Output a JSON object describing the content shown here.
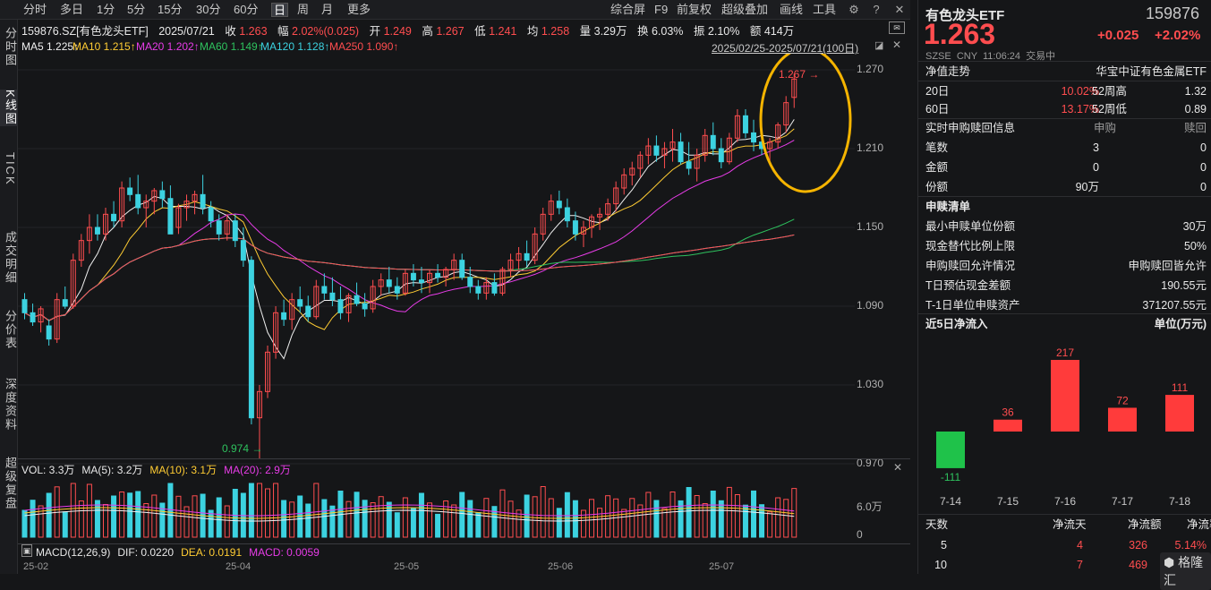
{
  "toolbar": {
    "tabs": [
      "分时",
      "多日",
      "1分",
      "5分",
      "15分",
      "30分",
      "60分",
      "日",
      "周",
      "月",
      "更多"
    ],
    "active_tab": "日",
    "right_items": [
      "综合屏",
      "F9",
      "前复权",
      "超级叠加",
      "画线",
      "工具"
    ]
  },
  "left_tabs": [
    "分时图",
    "K线图",
    "TICK",
    "成交明细",
    "分价表",
    "深度资料",
    "超级复盘"
  ],
  "info": {
    "code_name": "159876.SZ[有色龙头ETF]",
    "date": "2025/07/21",
    "close_label": "收",
    "close": "1.263",
    "change_label": "幅",
    "change": "2.02%(0.025)",
    "open_label": "开",
    "open": "1.249",
    "high_label": "高",
    "high": "1.267",
    "low_label": "低",
    "low": "1.241",
    "avg_label": "均",
    "avg": "1.258",
    "vol_label": "量",
    "vol": "3.29万",
    "turnover_label": "换",
    "turnover": "6.03%",
    "amp_label": "振",
    "amp": "2.10%",
    "amount_label": "额",
    "amount": "414万",
    "range": "2025/02/25-2025/07/21(100日)"
  },
  "ma_labels": [
    {
      "text": "MA5 1.225↑",
      "color": "#f0f0f0"
    },
    {
      "text": "MA10 1.215↑",
      "color": "#ffcc33"
    },
    {
      "text": "MA20 1.202↑",
      "color": "#e83ce8"
    },
    {
      "text": "MA60 1.149↑",
      "color": "#2ec25e"
    },
    {
      "text": "MA120 1.128↑",
      "color": "#3cd2e0"
    },
    {
      "text": "MA250 1.090↑",
      "color": "#ff4d4f"
    }
  ],
  "price_axis": [
    "1.270",
    "1.210",
    "1.150",
    "1.090",
    "1.030",
    "0.970"
  ],
  "annotations": {
    "high": "1.267",
    "low": "0.974"
  },
  "vol_panel": {
    "labels": [
      {
        "text": "VOL: 3.3万",
        "color": "#e8e8e8"
      },
      {
        "text": "MA(5): 3.2万",
        "color": "#e8e8e8"
      },
      {
        "text": "MA(10): 3.1万",
        "color": "#ffcc33"
      },
      {
        "text": "MA(20): 2.9万",
        "color": "#e83ce8"
      }
    ],
    "axis": [
      "6.0万",
      "0"
    ]
  },
  "macd_panel": {
    "labels": [
      {
        "text": "MACD(12,26,9)",
        "color": "#e8e8e8"
      },
      {
        "text": "DIF: 0.0220",
        "color": "#e8e8e8"
      },
      {
        "text": "DEA: 0.0191",
        "color": "#ffcc33"
      },
      {
        "text": "MACD: 0.0059",
        "color": "#e83ce8"
      }
    ]
  },
  "date_axis": [
    "25-02",
    "25-04",
    "25-05",
    "25-06",
    "25-07"
  ],
  "chart_data": {
    "type": "candlestick",
    "ylim": [
      0.97,
      1.27
    ],
    "candles": [
      [
        1.095,
        1.1,
        1.08,
        1.085
      ],
      [
        1.085,
        1.092,
        1.075,
        1.078
      ],
      [
        1.078,
        1.09,
        1.07,
        1.088
      ],
      [
        1.075,
        1.08,
        1.06,
        1.065
      ],
      [
        1.065,
        1.1,
        1.062,
        1.095
      ],
      [
        1.095,
        1.105,
        1.088,
        1.09
      ],
      [
        1.09,
        1.13,
        1.088,
        1.125
      ],
      [
        1.125,
        1.145,
        1.12,
        1.14
      ],
      [
        1.14,
        1.16,
        1.13,
        1.15
      ],
      [
        1.15,
        1.16,
        1.14,
        1.145
      ],
      [
        1.145,
        1.165,
        1.14,
        1.16
      ],
      [
        1.16,
        1.17,
        1.15,
        1.155
      ],
      [
        1.155,
        1.185,
        1.15,
        1.18
      ],
      [
        1.18,
        1.188,
        1.17,
        1.175
      ],
      [
        1.175,
        1.19,
        1.16,
        1.165
      ],
      [
        1.165,
        1.175,
        1.15,
        1.17
      ],
      [
        1.17,
        1.18,
        1.16,
        1.178
      ],
      [
        1.178,
        1.185,
        1.165,
        1.172
      ],
      [
        1.172,
        1.182,
        1.15,
        1.145
      ],
      [
        1.15,
        1.168,
        1.145,
        1.165
      ],
      [
        1.165,
        1.175,
        1.155,
        1.17
      ],
      [
        1.17,
        1.178,
        1.16,
        1.175
      ],
      [
        1.175,
        1.19,
        1.16,
        1.165
      ],
      [
        1.165,
        1.17,
        1.15,
        1.155
      ],
      [
        1.155,
        1.16,
        1.14,
        1.145
      ],
      [
        1.145,
        1.16,
        1.14,
        1.155
      ],
      [
        1.155,
        1.16,
        1.135,
        1.14
      ],
      [
        1.14,
        1.15,
        1.12,
        1.125
      ],
      [
        1.125,
        1.128,
        1.0,
        1.005
      ],
      [
        1.005,
        1.03,
        0.974,
        1.025
      ],
      [
        1.025,
        1.06,
        1.02,
        1.055
      ],
      [
        1.055,
        1.09,
        1.05,
        1.085
      ],
      [
        1.085,
        1.095,
        1.075,
        1.08
      ],
      [
        1.08,
        1.1,
        1.072,
        1.095
      ],
      [
        1.095,
        1.105,
        1.085,
        1.09
      ],
      [
        1.09,
        1.098,
        1.078,
        1.082
      ],
      [
        1.082,
        1.11,
        1.08,
        1.105
      ],
      [
        1.105,
        1.115,
        1.095,
        1.1
      ],
      [
        1.1,
        1.112,
        1.09,
        1.095
      ],
      [
        1.095,
        1.105,
        1.08,
        1.085
      ],
      [
        1.085,
        1.1,
        1.078,
        1.098
      ],
      [
        1.098,
        1.108,
        1.09,
        1.092
      ],
      [
        1.092,
        1.1,
        1.082,
        1.088
      ],
      [
        1.088,
        1.11,
        1.085,
        1.105
      ],
      [
        1.105,
        1.115,
        1.098,
        1.11
      ],
      [
        1.11,
        1.12,
        1.1,
        1.105
      ],
      [
        1.105,
        1.112,
        1.095,
        1.1
      ],
      [
        1.1,
        1.118,
        1.098,
        1.115
      ],
      [
        1.115,
        1.122,
        1.105,
        1.11
      ],
      [
        1.11,
        1.12,
        1.1,
        1.108
      ],
      [
        1.108,
        1.118,
        1.1,
        1.115
      ],
      [
        1.115,
        1.122,
        1.108,
        1.112
      ],
      [
        1.112,
        1.12,
        1.105,
        1.118
      ],
      [
        1.118,
        1.13,
        1.11,
        1.125
      ],
      [
        1.125,
        1.13,
        1.11,
        1.112
      ],
      [
        1.112,
        1.12,
        1.1,
        1.105
      ],
      [
        1.105,
        1.11,
        1.095,
        1.1
      ],
      [
        1.1,
        1.112,
        1.095,
        1.108
      ],
      [
        1.108,
        1.115,
        1.098,
        1.1
      ],
      [
        1.1,
        1.12,
        1.098,
        1.118
      ],
      [
        1.118,
        1.13,
        1.112,
        1.125
      ],
      [
        1.125,
        1.135,
        1.118,
        1.13
      ],
      [
        1.13,
        1.14,
        1.12,
        1.125
      ],
      [
        1.125,
        1.15,
        1.122,
        1.145
      ],
      [
        1.145,
        1.165,
        1.14,
        1.16
      ],
      [
        1.16,
        1.175,
        1.155,
        1.17
      ],
      [
        1.17,
        1.178,
        1.16,
        1.165
      ],
      [
        1.165,
        1.172,
        1.15,
        1.155
      ],
      [
        1.155,
        1.162,
        1.14,
        1.145
      ],
      [
        1.145,
        1.155,
        1.135,
        1.15
      ],
      [
        1.15,
        1.16,
        1.142,
        1.158
      ],
      [
        1.158,
        1.165,
        1.148,
        1.16
      ],
      [
        1.16,
        1.172,
        1.155,
        1.168
      ],
      [
        1.168,
        1.185,
        1.162,
        1.18
      ],
      [
        1.18,
        1.195,
        1.175,
        1.19
      ],
      [
        1.19,
        1.2,
        1.182,
        1.195
      ],
      [
        1.195,
        1.208,
        1.188,
        1.205
      ],
      [
        1.205,
        1.218,
        1.198,
        1.212
      ],
      [
        1.212,
        1.22,
        1.2,
        1.205
      ],
      [
        1.205,
        1.215,
        1.195,
        1.21
      ],
      [
        1.21,
        1.225,
        1.2,
        1.215
      ],
      [
        1.215,
        1.222,
        1.198,
        1.2
      ],
      [
        1.2,
        1.215,
        1.19,
        1.195
      ],
      [
        1.195,
        1.21,
        1.185,
        1.205
      ],
      [
        1.205,
        1.225,
        1.2,
        1.22
      ],
      [
        1.22,
        1.23,
        1.205,
        1.21
      ],
      [
        1.21,
        1.218,
        1.195,
        1.2
      ],
      [
        1.2,
        1.222,
        1.198,
        1.218
      ],
      [
        1.218,
        1.24,
        1.215,
        1.235
      ],
      [
        1.235,
        1.24,
        1.218,
        1.222
      ],
      [
        1.222,
        1.232,
        1.208,
        1.215
      ],
      [
        1.215,
        1.222,
        1.205,
        1.21
      ],
      [
        1.21,
        1.218,
        1.2,
        1.215
      ],
      [
        1.215,
        1.23,
        1.21,
        1.228
      ],
      [
        1.228,
        1.25,
        1.222,
        1.245
      ],
      [
        1.249,
        1.267,
        1.241,
        1.263
      ]
    ]
  },
  "right": {
    "name": "有色龙头ETF",
    "code": "159876",
    "price": "1.263",
    "change": "+0.025",
    "change_pct": "+2.02%",
    "sub": "SZSE  CNY  11:06:24  交易中",
    "nav_title": "净值走势",
    "nav_index": "华宝中证有色金属ETF",
    "stats": [
      {
        "k": "20日",
        "v": "10.02%",
        "k2": "52周高",
        "v2": "1.32"
      },
      {
        "k": "60日",
        "v": "13.17%",
        "k2": "52周低",
        "v2": "0.89"
      }
    ],
    "sub_title": "实时申购赎回信息",
    "sub_h1": "申购",
    "sub_h2": "赎回",
    "sub_rows": [
      {
        "k": "笔数",
        "a": "3",
        "b": "0"
      },
      {
        "k": "金额",
        "a": "0",
        "b": "0"
      },
      {
        "k": "份额",
        "a": "90万",
        "b": "0"
      }
    ],
    "list_title": "申赎清单",
    "list_rows": [
      {
        "k": "最小申赎单位份额",
        "v": "30万"
      },
      {
        "k": "现金替代比例上限",
        "v": "50%"
      },
      {
        "k": "申购赎回允许情况",
        "v": "申购赎回皆允许"
      },
      {
        "k": "T日预估现金差额",
        "v": "190.55元"
      },
      {
        "k": "T-1日单位申赎资产",
        "v": "371207.55元"
      }
    ],
    "flow_title": "近5日净流入",
    "flow_unit": "单位(万元)",
    "flow": [
      {
        "date": "7-14",
        "value": -111
      },
      {
        "date": "7-15",
        "value": 36
      },
      {
        "date": "7-16",
        "value": 217
      },
      {
        "date": "7-17",
        "value": 72
      },
      {
        "date": "7-18",
        "value": 111
      }
    ],
    "table_headers": [
      "天数",
      "净流天",
      "净流额",
      "净流率"
    ],
    "table_rows": [
      {
        "d": "5",
        "a": "4",
        "b": "326",
        "c": "5.14%"
      },
      {
        "d": "10",
        "a": "7",
        "b": "469",
        "c": ""
      }
    ],
    "watermark": "格隆汇"
  }
}
